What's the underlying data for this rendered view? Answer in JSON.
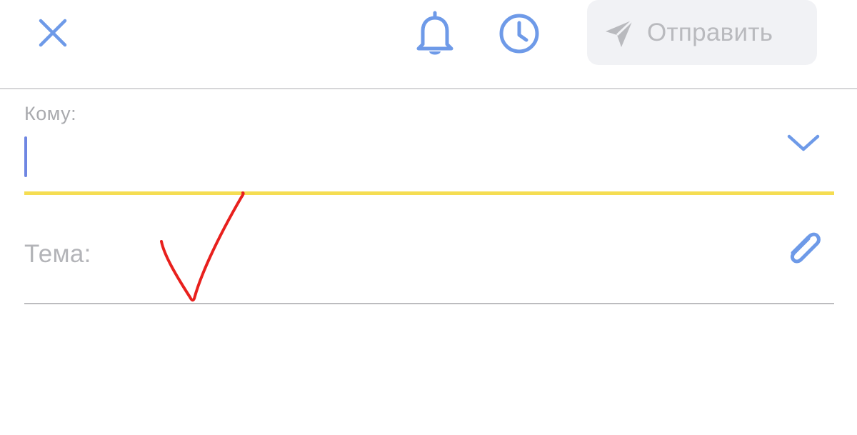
{
  "toolbar": {
    "close_icon": "close-icon",
    "reminder_icon": "bell-icon",
    "schedule_icon": "clock-icon",
    "send_icon": "paper-plane-icon",
    "send_label": "Отправить"
  },
  "compose": {
    "to_label": "Кому:",
    "to_value": "",
    "expand_icon": "chevron-down-icon",
    "subject_label": "Тема:",
    "subject_value": "",
    "attach_icon": "paperclip-icon"
  },
  "colors": {
    "accent_blue": "#6e9ae8",
    "send_bg": "#f1f2f5",
    "send_text": "#b9babe",
    "active_underline": "#f5dd52",
    "caret": "#6f86e2",
    "annotation_red": "#e8201d"
  }
}
